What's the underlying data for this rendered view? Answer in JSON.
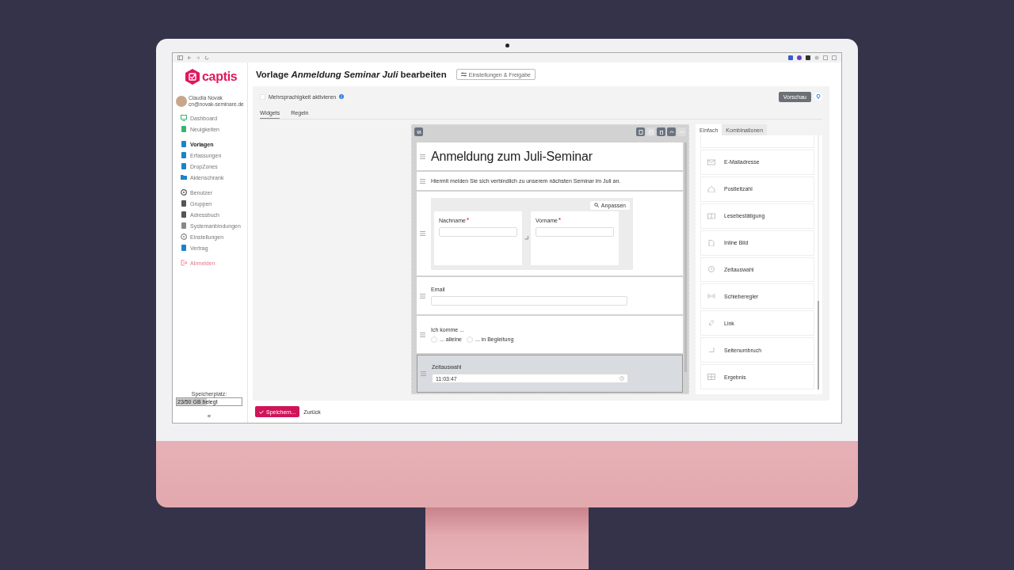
{
  "app": {
    "logo": "captis"
  },
  "user": {
    "name": "Claudia Novak",
    "email": "cn@novak-seminare.de"
  },
  "nav": {
    "groups": [
      {
        "items": [
          {
            "label": "Dashboard",
            "selected": false,
            "kind": "link"
          },
          {
            "label": "Neuigkeiten",
            "selected": false,
            "kind": "link"
          }
        ]
      },
      {
        "items": [
          {
            "label": "Vorlagen",
            "selected": true,
            "kind": "link"
          },
          {
            "label": "Erfassungen",
            "selected": false,
            "kind": "link"
          },
          {
            "label": "DropZones",
            "selected": false,
            "kind": "link"
          },
          {
            "label": "Aktenschrank",
            "selected": false,
            "kind": "link"
          }
        ]
      },
      {
        "items": [
          {
            "label": "Benutzer",
            "selected": false,
            "kind": "link"
          },
          {
            "label": "Gruppen",
            "selected": false,
            "kind": "link"
          },
          {
            "label": "Adressbuch",
            "selected": false,
            "kind": "link"
          },
          {
            "label": "Systemanbindungen",
            "selected": false,
            "kind": "link"
          },
          {
            "label": "Einstellungen",
            "selected": false,
            "kind": "link"
          },
          {
            "label": "Vertrag",
            "selected": false,
            "kind": "link"
          }
        ]
      },
      {
        "items": [
          {
            "label": "Abmelden",
            "selected": false,
            "kind": "logout"
          }
        ]
      }
    ]
  },
  "storage": {
    "label": "Speicherplatz:",
    "text": "23/50 GB belegt",
    "level": 0.46
  },
  "collapse": "«",
  "page": {
    "title": "Vorlage *Anmeldung Seminar Juli* bearbeiten",
    "settings_button": "Einstellungen & Freigabe"
  },
  "multilang": {
    "label": "Mehrsprachigkeit aktivieren",
    "checked": false
  },
  "preview_button": "Vorschau",
  "tabs": [
    {
      "label": "Widgets",
      "selected": true
    },
    {
      "label": "Regeln",
      "selected": false
    }
  ],
  "canvas": {
    "tools": [
      {
        "kind": "copy",
        "disabled": false
      },
      {
        "kind": "paste",
        "disabled": true
      },
      {
        "kind": "delete",
        "disabled": false
      },
      {
        "kind": "undo",
        "disabled": false
      },
      {
        "kind": "redo",
        "disabled": true
      }
    ],
    "widgets": [
      {
        "kind": "heading",
        "selected": false,
        "text": "Anmeldung zum Juli-Seminar"
      },
      {
        "kind": "paragraph",
        "selected": false,
        "text": "Hiermit melden Sie sich verbindlich zu unserem nächsten Seminar im Juli an."
      },
      {
        "kind": "columns",
        "selected": false,
        "button": "Anpassen",
        "fields": [
          {
            "label": "Nachname",
            "required": true
          },
          {
            "label": "Vorname",
            "required": true
          }
        ]
      },
      {
        "kind": "field",
        "selected": false,
        "label": "Email"
      },
      {
        "kind": "radio",
        "selected": false,
        "label": "Ich komme ...",
        "options": [
          {
            "label": "... alleine",
            "checked": false
          },
          {
            "label": "... in Begleitung",
            "checked": false
          }
        ]
      },
      {
        "kind": "time",
        "selected": true,
        "label": "Zeitauswahl",
        "value": "11:03:47"
      }
    ]
  },
  "palette": {
    "tabs": [
      {
        "label": "Einfach",
        "selected": true
      },
      {
        "label": "Kombinationen",
        "selected": false
      }
    ],
    "items": [
      {
        "label": "E-Mailadresse"
      },
      {
        "label": "Postleitzahl"
      },
      {
        "label": "Lesebestätigung"
      },
      {
        "label": "Inline Bild"
      },
      {
        "label": "Zeitauswahl"
      },
      {
        "label": "Schieberegler"
      },
      {
        "label": "Link"
      },
      {
        "label": "Seitenumbruch"
      },
      {
        "label": "Ergebnis"
      }
    ]
  },
  "footer": {
    "save": "Speichern...",
    "back": "Zurück"
  }
}
